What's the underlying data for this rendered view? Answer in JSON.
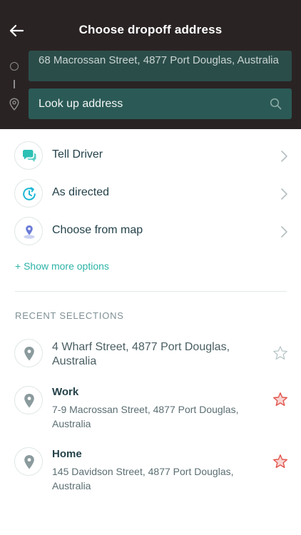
{
  "header": {
    "title": "Choose dropoff address",
    "pickup_address": "68 Macrossan Street, 4877 Port Douglas, Australia",
    "dropoff_placeholder": "Look up address",
    "dropoff_value": ""
  },
  "options": {
    "items": [
      {
        "label": "Tell Driver",
        "icon": "chat-bubble-icon",
        "color": "#2cc1b4"
      },
      {
        "label": "As directed",
        "icon": "clock-refresh-icon",
        "color": "#1ab7d4"
      },
      {
        "label": "Choose from map",
        "icon": "map-pin-icon",
        "color": "#6b7bd6"
      }
    ],
    "show_more": "+ Show more options"
  },
  "recent": {
    "title": "RECENT SELECTIONS",
    "items": [
      {
        "name": "",
        "address": "4 Wharf Street, 4877 Port Douglas, Australia",
        "favorite": false
      },
      {
        "name": "Work",
        "address": "7-9 Macrossan Street, 4877 Port Douglas, Australia",
        "favorite": true
      },
      {
        "name": "Home",
        "address": "145 Davidson Street, 4877 Port Douglas, Australia",
        "favorite": true
      }
    ]
  },
  "colors": {
    "header_bg": "#2a2324",
    "field_bg": "#2b5a56",
    "accent": "#2cb3a7",
    "star_favorite": "#e2544d",
    "star_empty": "#b9c6c8"
  }
}
